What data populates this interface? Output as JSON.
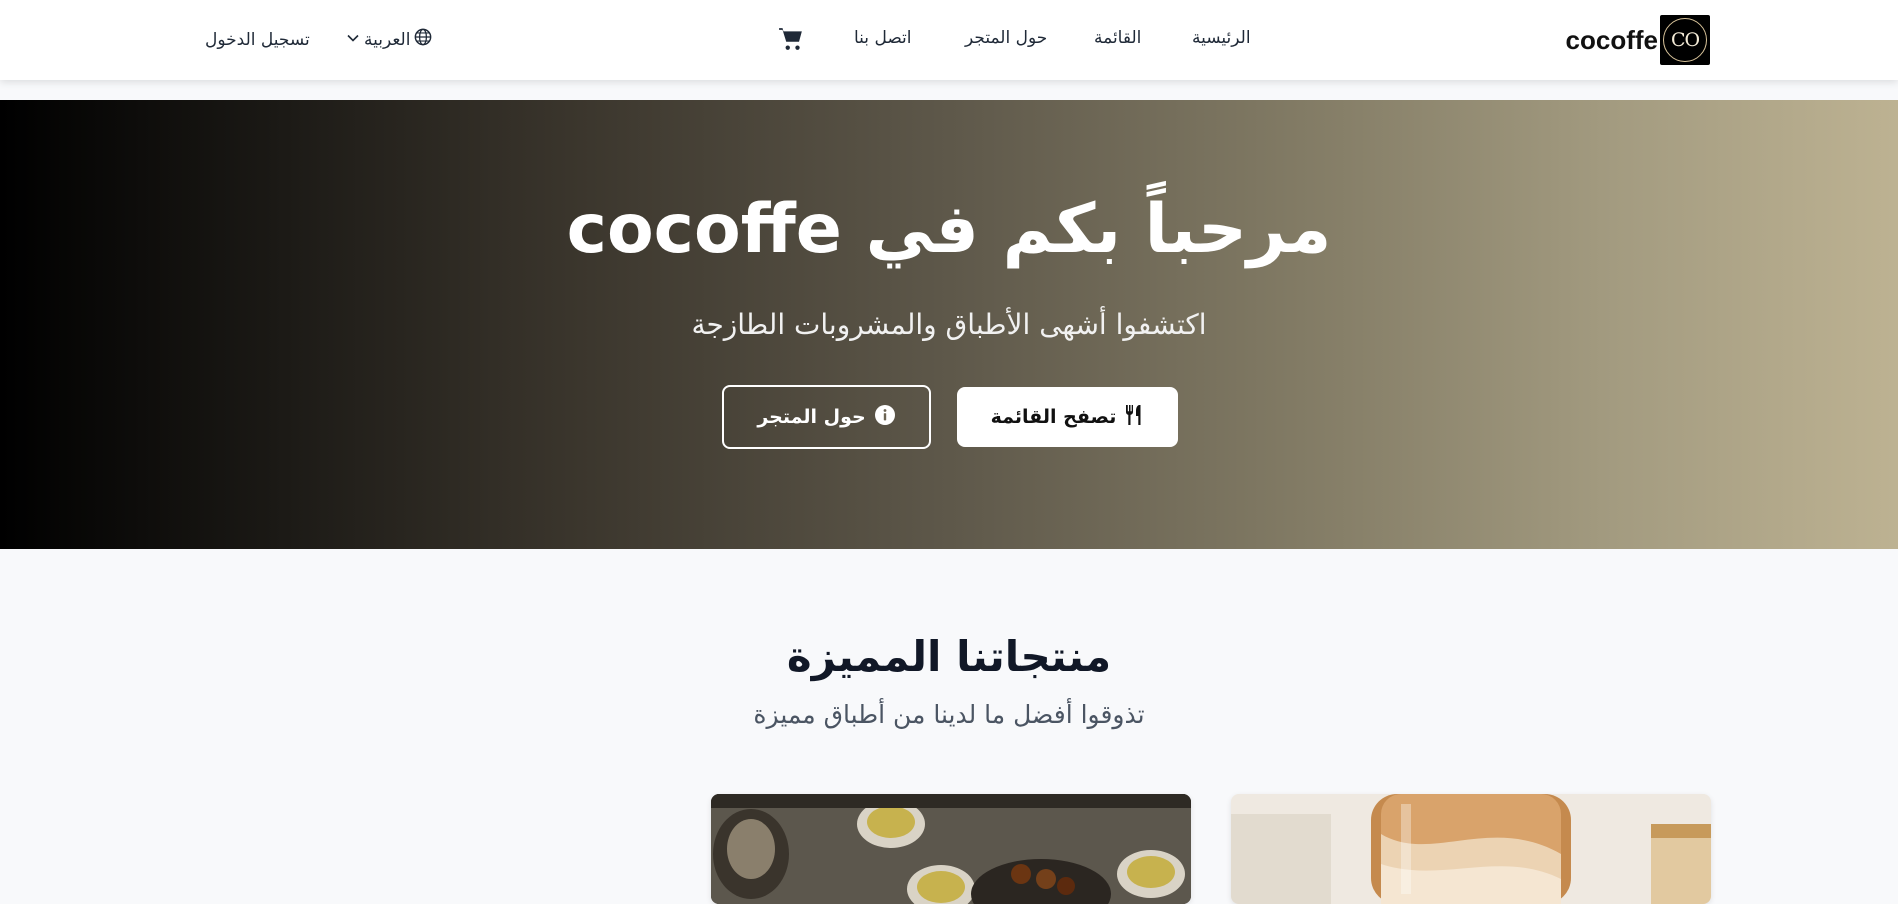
{
  "navbar": {
    "brand_name": "cocoffe",
    "brand_logo_text": "CO",
    "links": {
      "home": "الرئيسية",
      "menu": "القائمة",
      "about": "حول المتجر",
      "contact": "اتصل بنا"
    },
    "language": "العربية",
    "login": "تسجيل الدخول",
    "cart_icon": "shopping-cart-icon"
  },
  "hero": {
    "title": "مرحباً بكم في cocoffe",
    "subtitle": "اكتشفوا أشهى الأطباق والمشروبات الطازجة",
    "browse_menu_button": "تصفح القائمة",
    "about_button": "حول المتجر"
  },
  "featured": {
    "title": "منتجاتنا المميزة",
    "subtitle": "تذوقوا أفضل ما لدينا من أطباق مميزة"
  },
  "colors": {
    "hero_gradient_start": "#000000",
    "hero_gradient_end": "#bdb292",
    "page_background": "#f8f9fb"
  }
}
